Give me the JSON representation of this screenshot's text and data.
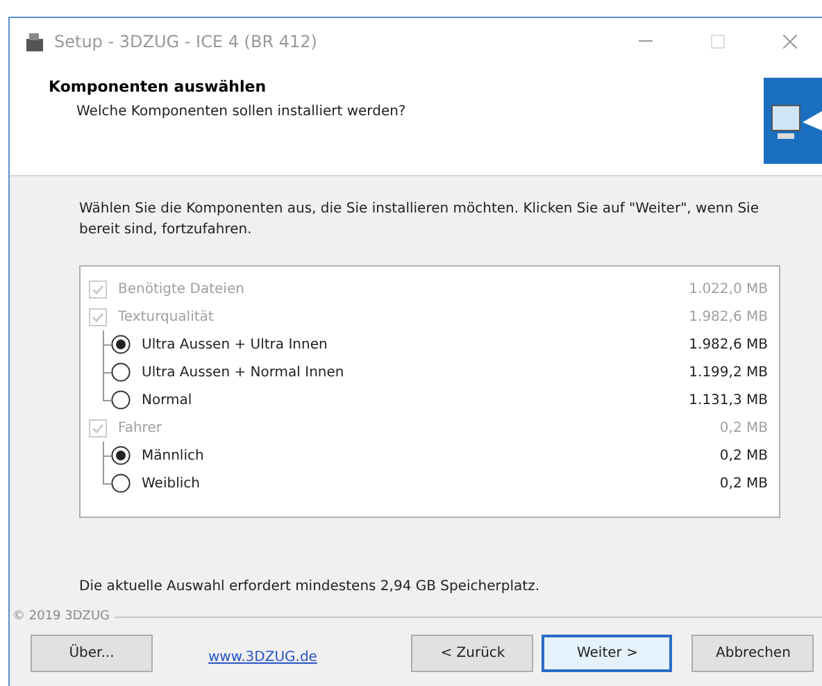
{
  "window": {
    "title": "Setup - 3DZUG - ICE 4 (BR 412)"
  },
  "header": {
    "title": "Komponenten auswählen",
    "subtitle": "Welche Komponenten sollen installiert werden?"
  },
  "instruction": "Wählen Sie die Komponenten aus, die Sie installieren möchten. Klicken Sie auf \"Weiter\", wenn Sie bereit sind, fortzufahren.",
  "components": [
    {
      "kind": "checkbox",
      "label": "Benötigte Dateien",
      "size": "1.022,0 MB",
      "checked": true,
      "disabled": true
    },
    {
      "kind": "checkbox",
      "label": "Texturqualität",
      "size": "1.982,6 MB",
      "checked": true,
      "disabled": true,
      "children": [
        {
          "kind": "radio",
          "label": "Ultra Aussen + Ultra Innen",
          "size": "1.982,6 MB",
          "selected": true
        },
        {
          "kind": "radio",
          "label": "Ultra Aussen + Normal Innen",
          "size": "1.199,2 MB",
          "selected": false
        },
        {
          "kind": "radio",
          "label": "Normal",
          "size": "1.131,3 MB",
          "selected": false
        }
      ]
    },
    {
      "kind": "checkbox",
      "label": "Fahrer",
      "size": "0,2 MB",
      "checked": true,
      "disabled": true,
      "children": [
        {
          "kind": "radio",
          "label": "Männlich",
          "size": "0,2 MB",
          "selected": true
        },
        {
          "kind": "radio",
          "label": "Weiblich",
          "size": "0,2 MB",
          "selected": false
        }
      ]
    }
  ],
  "disk_requirement": "Die aktuelle Auswahl erfordert mindestens 2,94 GB Speicherplatz.",
  "copyright": "© 2019 3DZUG",
  "buttons": {
    "about": "Über...",
    "link": "www.3DZUG.de",
    "back": "< Zurück",
    "next": "Weiter >",
    "cancel": "Abbrechen"
  }
}
